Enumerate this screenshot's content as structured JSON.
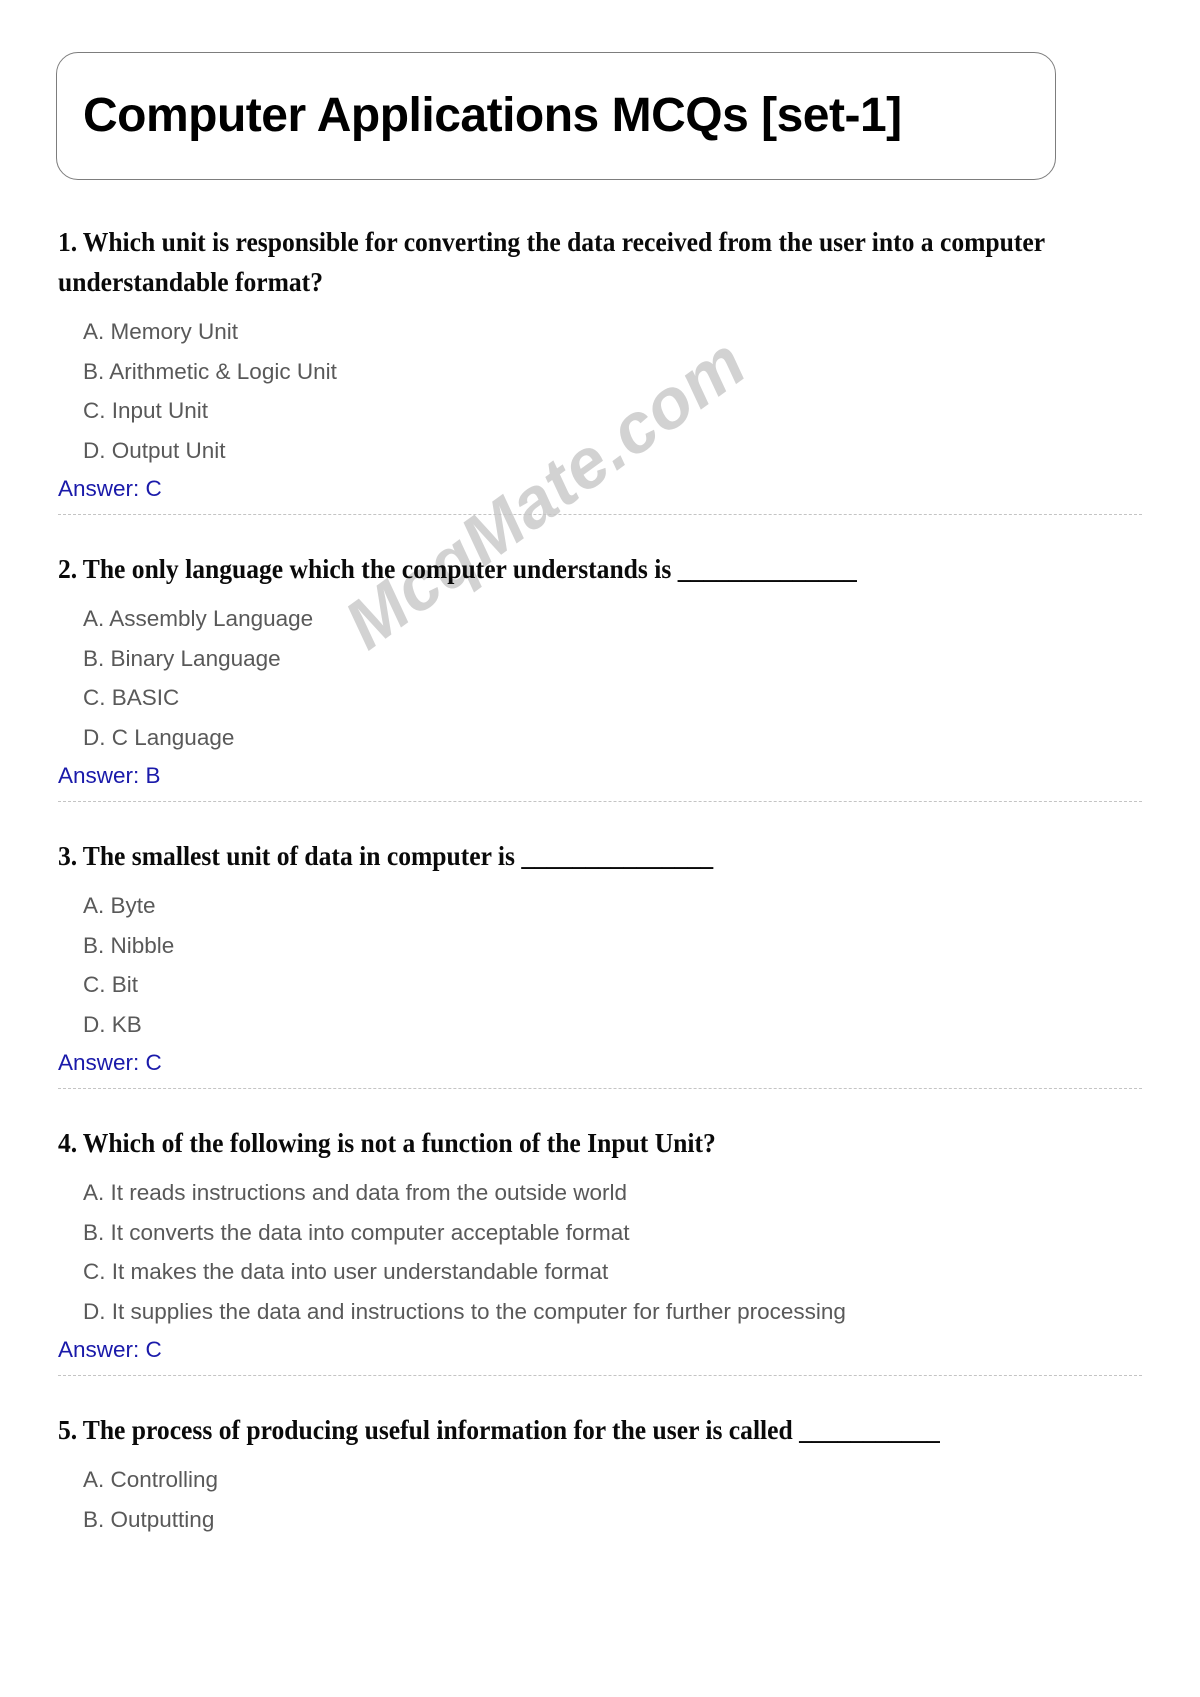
{
  "document": {
    "title": "Computer Applications MCQs [set-1]",
    "watermark": "McqMate.com",
    "answer_prefix": "Answer: ",
    "accent_color": "#1a1aaa",
    "question_color": "#0a0a0a",
    "option_color": "#595959",
    "border_color": "#7d7d7d",
    "watermark_color": "#d2d2d2"
  },
  "questions": [
    {
      "number": "1.",
      "text": "Which unit is responsible for converting the data received from the user into a computer understandable format?",
      "options": [
        "A. Memory Unit",
        "B. Arithmetic & Logic Unit",
        "C. Input Unit",
        "D. Output Unit"
      ],
      "answer": "Answer: C"
    },
    {
      "number": "2.",
      "text": "The only language which the computer understands is ______________",
      "options": [
        "A. Assembly Language",
        "B. Binary Language",
        "C. BASIC",
        "D. C Language"
      ],
      "answer": "Answer: B"
    },
    {
      "number": "3.",
      "text": "The smallest unit of data in computer is _______________",
      "options": [
        "A. Byte",
        "B. Nibble",
        "C. Bit",
        "D. KB"
      ],
      "answer": "Answer: C"
    },
    {
      "number": "4.",
      "text": "Which of the following is not a function of the Input Unit?",
      "options": [
        "A. It reads instructions and data from the outside world",
        "B. It converts the data into computer acceptable format",
        "C. It makes the data into user understandable format",
        "D. It supplies the data and instructions to the computer for further processing"
      ],
      "answer": "Answer: C"
    },
    {
      "number": "5.",
      "text": "The process of producing useful information for the user is called ___________",
      "options": [
        "A. Controlling",
        "B. Outputting"
      ],
      "answer": null
    }
  ]
}
